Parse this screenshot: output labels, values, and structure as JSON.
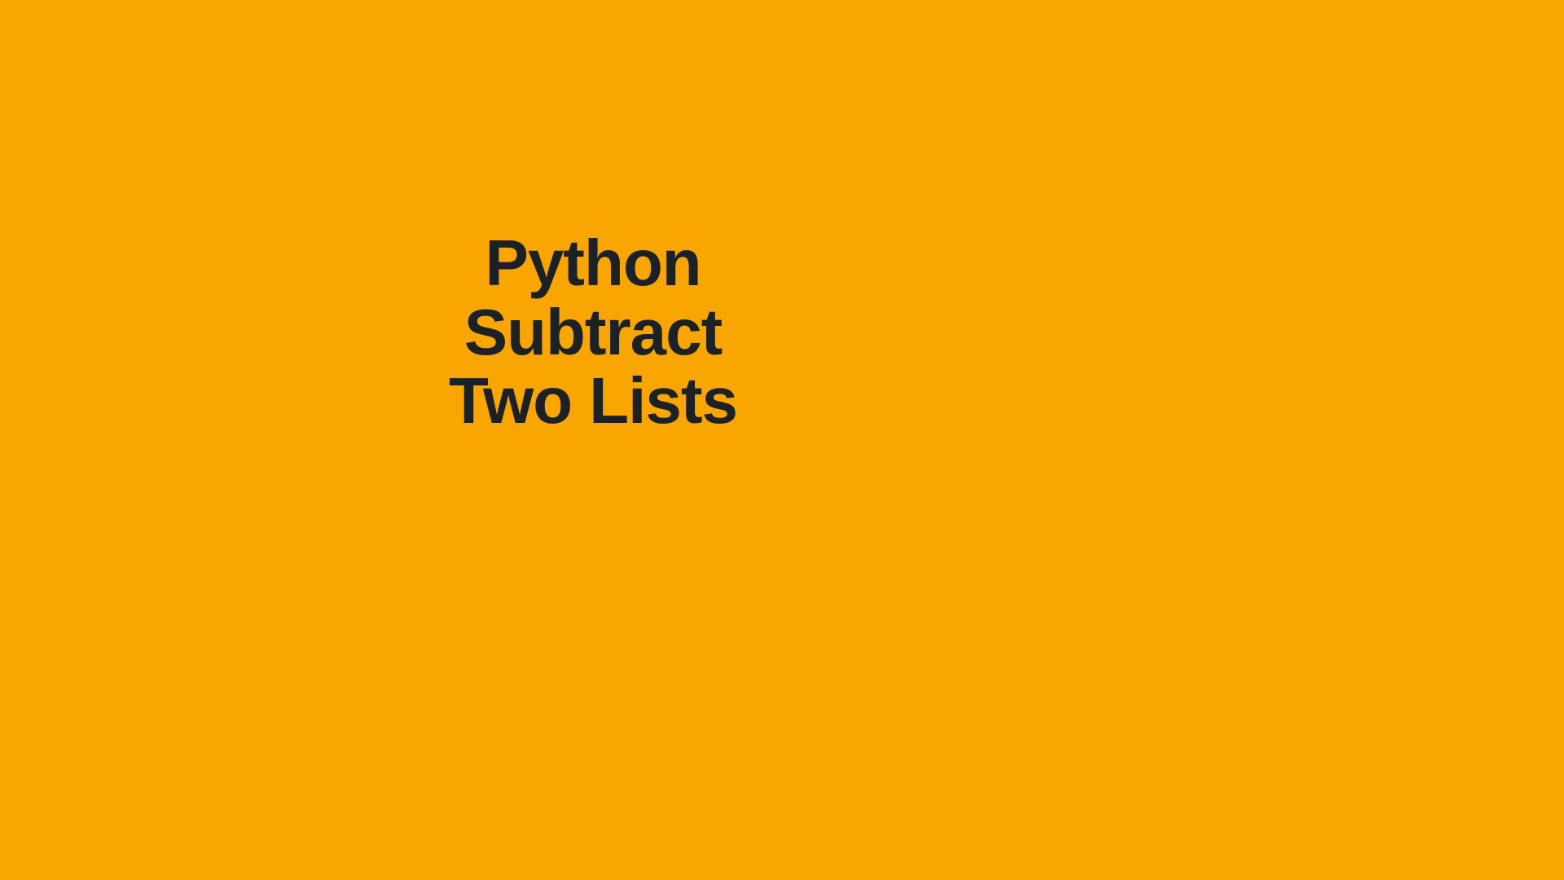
{
  "title": {
    "line1": "Python",
    "line2": "Subtract",
    "line3": "Two Lists"
  },
  "colors": {
    "background": "#F9A602",
    "text": "#1C2126"
  }
}
